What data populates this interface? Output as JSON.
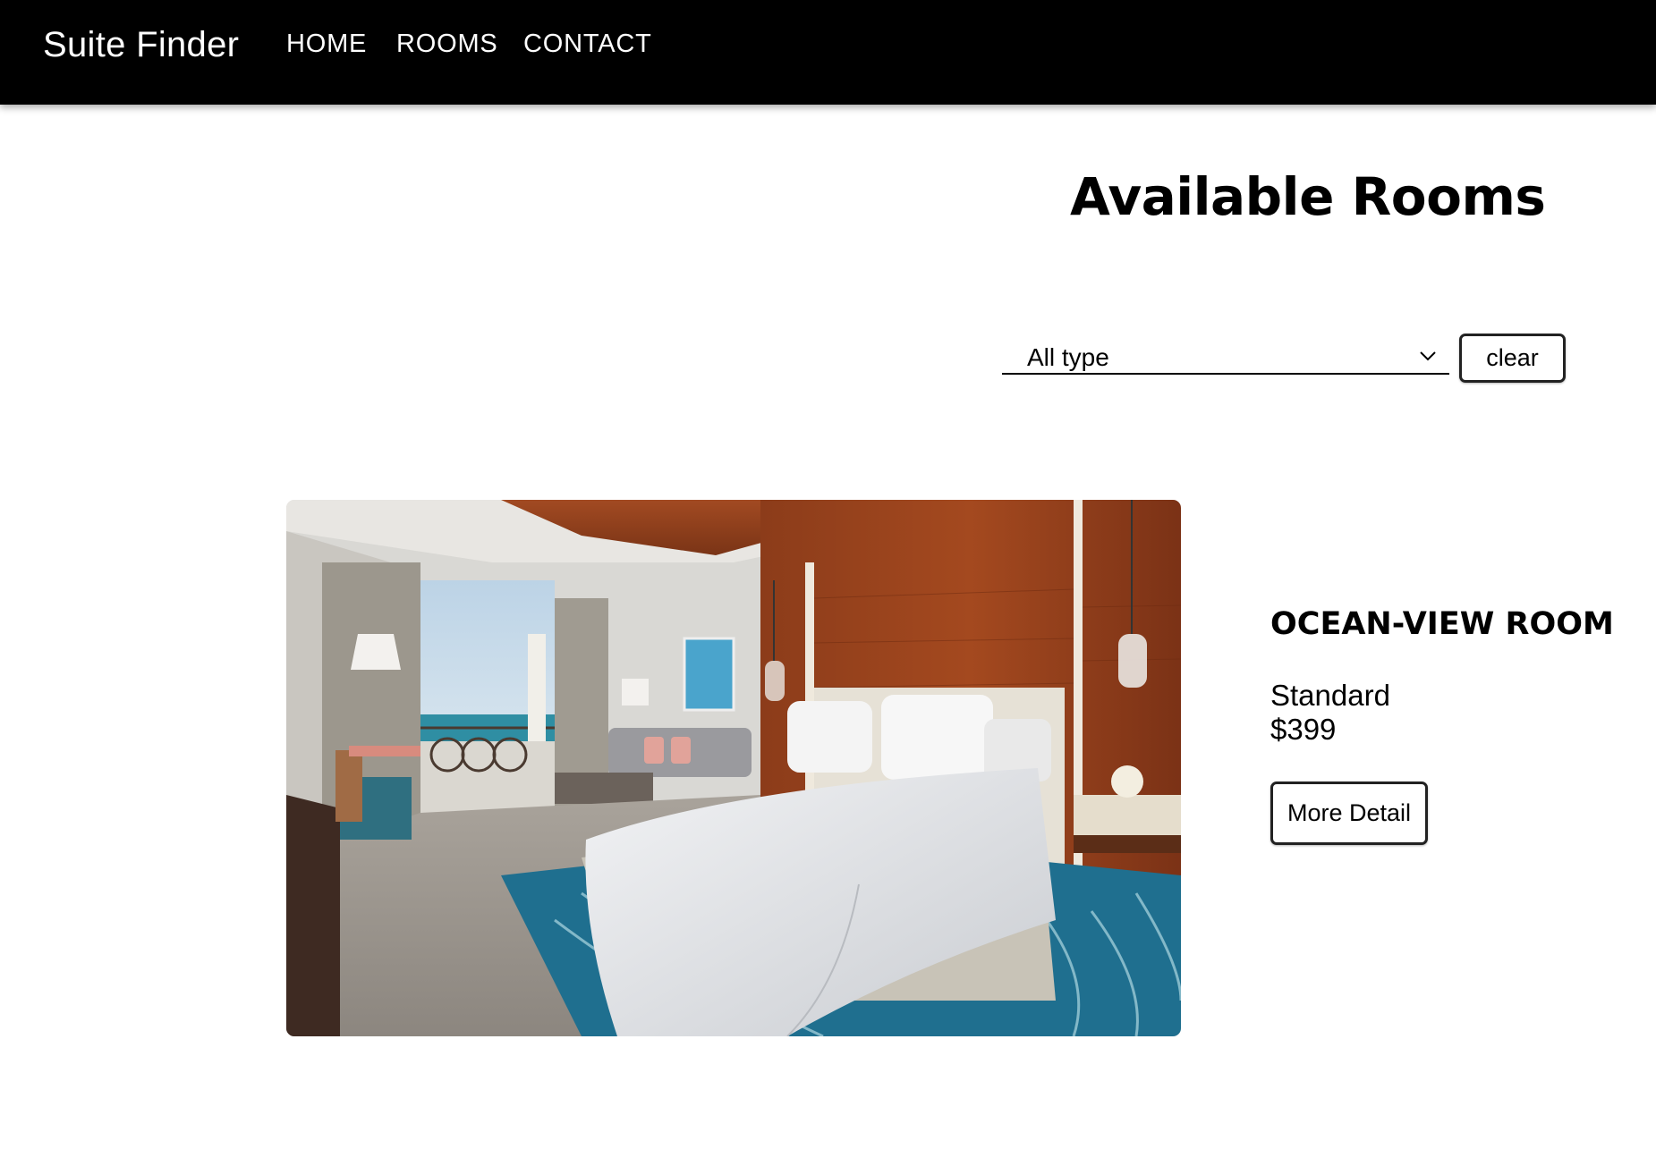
{
  "nav": {
    "brand": "Suite Finder",
    "links": [
      "HOME",
      "ROOMS",
      "CONTACT"
    ]
  },
  "main": {
    "title": "Available Rooms",
    "filter": {
      "selected": "All type",
      "clear_label": "clear"
    },
    "rooms": [
      {
        "name": "OCEAN-VIEW ROOM",
        "type": "Standard",
        "price": "$399",
        "button_label": "More Detail"
      }
    ]
  },
  "colors": {
    "navbar_bg": "#000000",
    "page_bg": "#ffffff",
    "text": "#000000"
  },
  "icons": {
    "select_caret": "chevron-down-icon"
  }
}
